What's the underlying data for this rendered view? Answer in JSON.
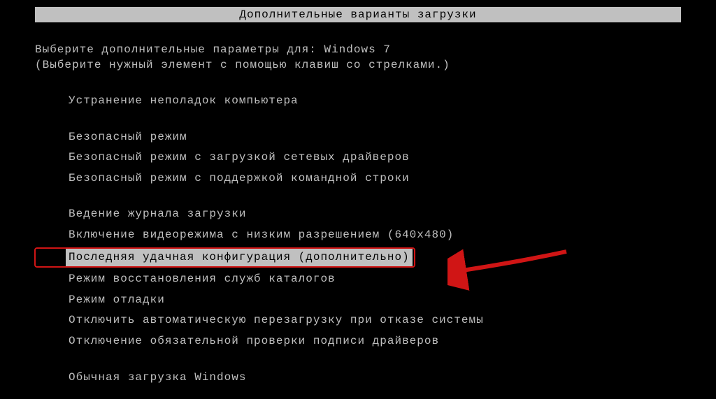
{
  "title": "Дополнительные варианты загрузки",
  "prompt_prefix": "Выберите дополнительные параметры для: ",
  "os_name": "Windows 7",
  "instruction": "(Выберите нужный элемент с помощью клавиш со стрелками.)",
  "groups": [
    {
      "items": [
        {
          "label": "Устранение неполадок компьютера",
          "selected": false,
          "highlighted": false
        }
      ]
    },
    {
      "items": [
        {
          "label": "Безопасный режим",
          "selected": false,
          "highlighted": false
        },
        {
          "label": "Безопасный режим с загрузкой сетевых драйверов",
          "selected": false,
          "highlighted": false
        },
        {
          "label": "Безопасный режим с поддержкой командной строки",
          "selected": false,
          "highlighted": false
        }
      ]
    },
    {
      "items": [
        {
          "label": "Ведение журнала загрузки",
          "selected": false,
          "highlighted": false
        },
        {
          "label": "Включение видеорежима с низким разрешением (640x480)",
          "selected": false,
          "highlighted": false
        },
        {
          "label": "Последняя удачная конфигурация (дополнительно)",
          "selected": true,
          "highlighted": true
        },
        {
          "label": "Режим восстановления служб каталогов",
          "selected": false,
          "highlighted": false
        },
        {
          "label": "Режим отладки",
          "selected": false,
          "highlighted": false
        },
        {
          "label": "Отключить автоматическую перезагрузку при отказе системы",
          "selected": false,
          "highlighted": false
        },
        {
          "label": "Отключение обязательной проверки подписи драйверов",
          "selected": false,
          "highlighted": false
        }
      ]
    },
    {
      "items": [
        {
          "label": "Обычная загрузка Windows",
          "selected": false,
          "highlighted": false
        }
      ]
    }
  ]
}
